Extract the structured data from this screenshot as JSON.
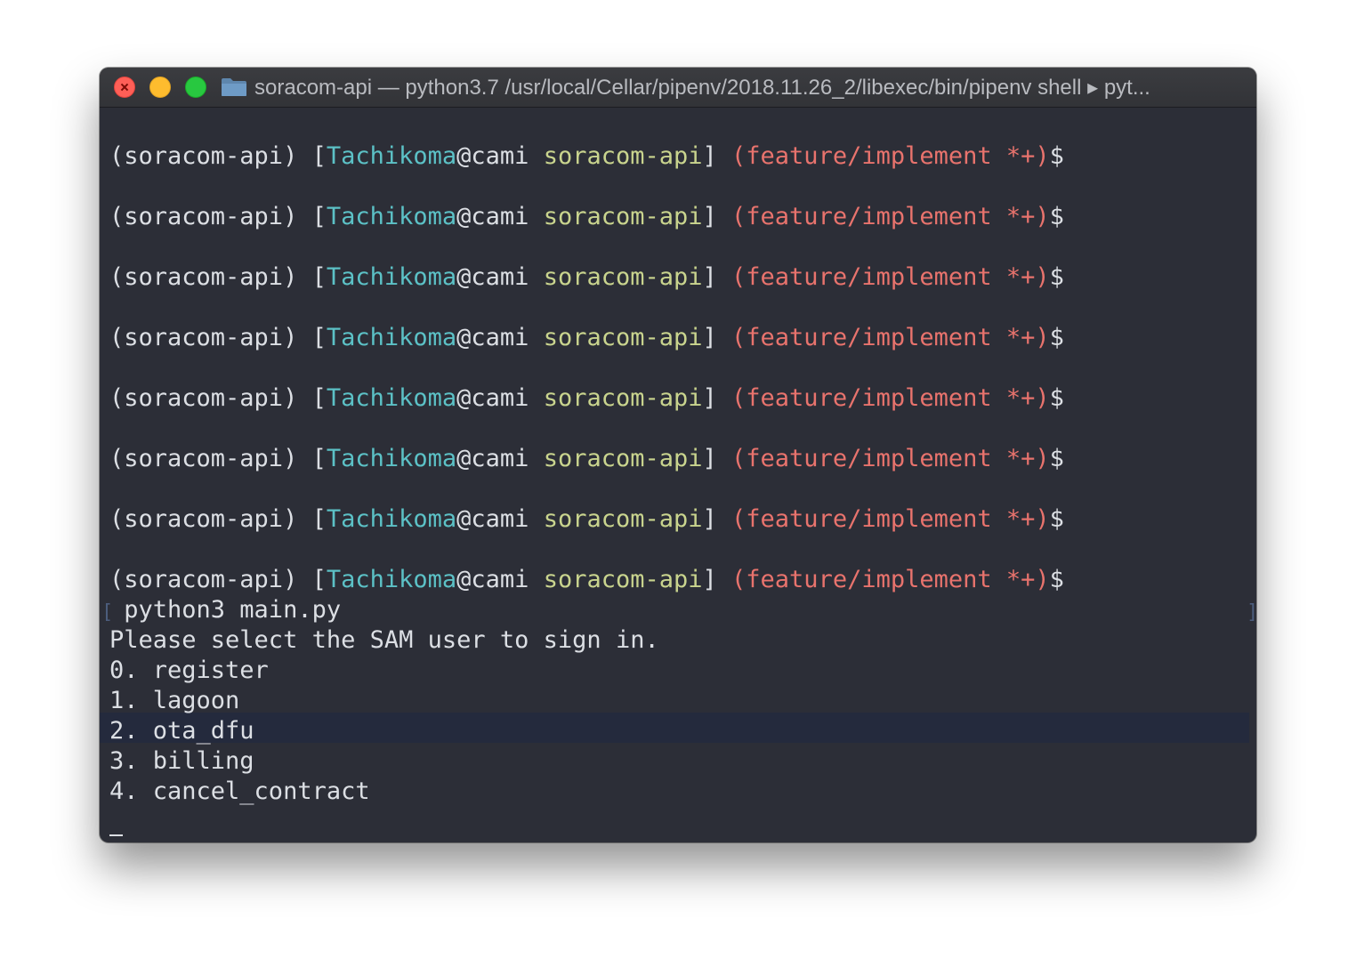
{
  "window": {
    "title": "soracom-api — python3.7 /usr/local/Cellar/pipenv/2018.11.26_2/libexec/bin/pipenv shell ▸ pyt..."
  },
  "colors": {
    "background": "#2c2e37",
    "user": "#5cc1c6",
    "directory": "#c9d48e",
    "branch": "#e8736d",
    "text": "#dcdfe4",
    "selection": "#242a3d"
  },
  "prompt": {
    "venv": "(soracom-api) ",
    "open_bracket": "[",
    "user": "Tachikoma",
    "host": "@cami ",
    "directory": "soracom-api",
    "close_bracket": "] ",
    "branch": "(feature/implement *+)",
    "symbol": "$"
  },
  "terminal": {
    "command": " python3 main.py",
    "heading": "Please select the SAM user to sign in.",
    "options": [
      "0. register",
      "1. lagoon",
      "2. ota_dfu",
      "3. billing",
      "4. cancel_contract"
    ],
    "cursor": "_"
  }
}
